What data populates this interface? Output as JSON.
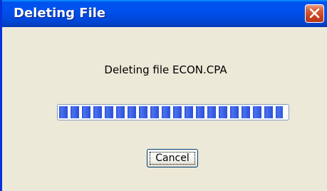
{
  "window": {
    "title": "Deleting File"
  },
  "dialog": {
    "message": "Deleting file ECON.CPA",
    "progress": 0.98,
    "cancel_label": "Cancel"
  },
  "icons": {
    "close": "close-icon"
  },
  "colors": {
    "titlebar": "#0054e3",
    "close_button": "#d8603a",
    "progress_block": "#2d4fd6",
    "dialog_background": "#ece9d8"
  }
}
